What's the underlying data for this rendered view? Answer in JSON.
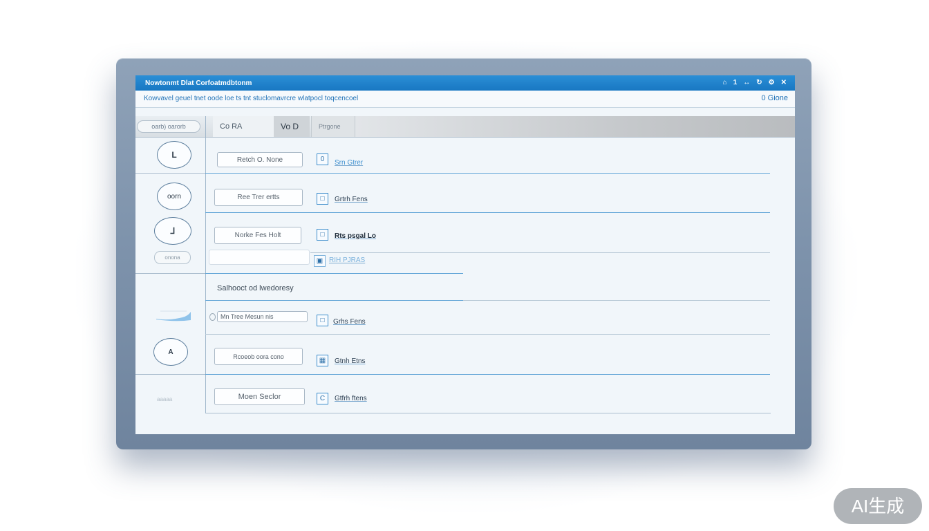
{
  "window": {
    "title": "Nowtonmt Dlat Corfoatmdbtonm",
    "controls": [
      "⌂",
      "1",
      "↔",
      "↻",
      "⚙",
      "✕"
    ]
  },
  "subheader": {
    "description": "Kowvavel geuel tnet oode loe ts tnt stuclomavrcre wlatpocl toqcencoel",
    "count": "0 Gione"
  },
  "tabs": {
    "side": "oarb) oarorb",
    "items": [
      "Co RA",
      "Vo D",
      "Ptrgone"
    ]
  },
  "rows": [
    {
      "avatar": "L",
      "button": "Retch  O. None",
      "check": "0",
      "link": "Srn Gtrer",
      "link_style": "blue"
    },
    {
      "avatar": "oorn",
      "button": "Ree Trer ertts",
      "check": "□",
      "link": "Grtrh Fens",
      "link_style": "normal"
    },
    {
      "avatar": "⅃",
      "button": "Norke Fes Holt",
      "check": "□",
      "link": "Rts psgal Lo",
      "link_style": "bold",
      "side_pill": "onona"
    },
    {
      "avatar": "",
      "button": "",
      "check": "▣",
      "link": "RIH PJRAS",
      "link_style": "blue"
    }
  ],
  "section": {
    "label": "Salhooct od lwedoresy",
    "rows": [
      {
        "avatar": "",
        "button": "Mn Tree  Mesun nis",
        "check": "□",
        "link": "Grhs Fens"
      },
      {
        "avatar": "A",
        "button": "Rcoeob oora cono",
        "check": "▦",
        "link": "Gtnh Etns"
      },
      {
        "avatar": "",
        "button": "Moen Seclor",
        "check": "C",
        "link": "Gtfrh ftens",
        "side_label": "aaaaa"
      }
    ]
  },
  "watermark": "AI生成"
}
